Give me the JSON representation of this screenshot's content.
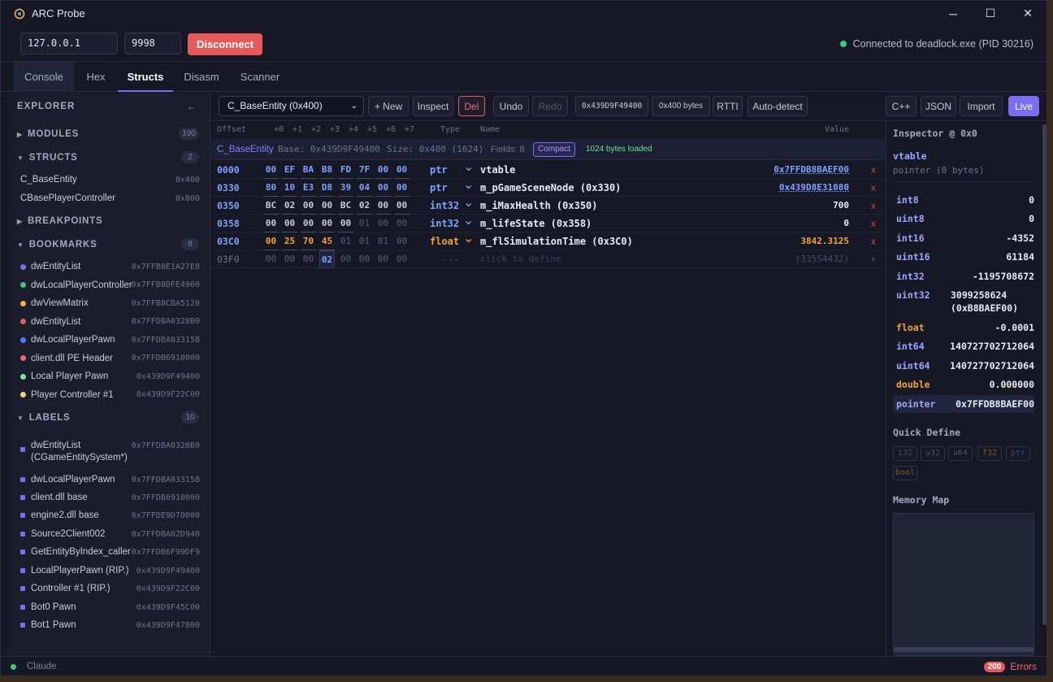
{
  "window": {
    "title": "ARC Probe",
    "minimize": "─",
    "maximize": "☐",
    "close": "✕"
  },
  "connection": {
    "host": "127.0.0.1",
    "port": "9998",
    "disconnect_label": "Disconnect",
    "status": "Connected to deadlock.exe (PID 30216)",
    "status_color": "#3ec97a"
  },
  "tabs": [
    "Console",
    "Hex",
    "Structs",
    "Disasm",
    "Scanner"
  ],
  "active_tab": "Structs",
  "sidebar": {
    "title": "EXPLORER",
    "collapse": "←",
    "modules": {
      "label": "MODULES",
      "count": "190"
    },
    "structs": {
      "label": "STRUCTS",
      "count": "2",
      "items": [
        {
          "name": "C_BaseEntity",
          "size": "0x400"
        },
        {
          "name": "CBasePlayerController",
          "size": "0x800"
        }
      ]
    },
    "breakpoints": {
      "label": "BREAKPOINTS"
    },
    "bookmarks": {
      "label": "BOOKMARKS",
      "count": "8",
      "items": [
        {
          "name": "dwEntityList",
          "addr": "0x7FFB0E1A27E8",
          "color": "#7c6df2"
        },
        {
          "name": "dwLocalPlayerController",
          "addr": "0x7FFB0DFE4900",
          "color": "#3ec97a"
        },
        {
          "name": "dwViewMatrix",
          "addr": "0x7FFB0CBA5120",
          "color": "#f0b43a"
        },
        {
          "name": "dwEntityList",
          "addr": "0x7FFDBA0328B0",
          "color": "#e45a5a"
        },
        {
          "name": "dwLocalPlayerPawn",
          "addr": "0x7FFDBA033158",
          "color": "#4a7cff"
        },
        {
          "name": "client.dll PE Header",
          "addr": "0x7FFDB6910000",
          "color": "#f06a6a"
        },
        {
          "name": "Local Player Pawn",
          "addr": "0x439D9F49400",
          "color": "#7ee0a0"
        },
        {
          "name": "Player Controller #1",
          "addr": "0x439D9F22C00",
          "color": "#f0d070"
        }
      ]
    },
    "labels": {
      "label": "LABELS",
      "count": "10",
      "items": [
        {
          "name": "dwEntityList",
          "name2": "(CGameEntitySystem*)",
          "addr": "0x7FFDBA0328B0"
        },
        {
          "name": "dwLocalPlayerPawn",
          "addr": "0x7FFDBA033158"
        },
        {
          "name": "client.dll base",
          "addr": "0x7FFDB6910000"
        },
        {
          "name": "engine2.dll base",
          "addr": "0x7FFDE9D70000"
        },
        {
          "name": "Source2Client002",
          "addr": "0x7FFDBA02D940"
        },
        {
          "name": "GetEntityByIndex_caller",
          "addr": "0x7FFDB6F99DF9"
        },
        {
          "name": "LocalPlayerPawn (RIP.)",
          "addr": "0x439D9F49400"
        },
        {
          "name": "Controller #1 (RIP.)",
          "addr": "0x439D9F22C00"
        },
        {
          "name": "Bot0 Pawn",
          "addr": "0x439D9F45C00"
        },
        {
          "name": "Bot1 Pawn",
          "addr": "0x439D9F47800"
        }
      ]
    }
  },
  "toolbar": {
    "struct_select": "C_BaseEntity (0x400)",
    "new": "+ New",
    "inspect": "Inspect",
    "del": "Del",
    "undo": "Undo",
    "redo": "Redo",
    "address": "0x439D9F49400",
    "size": "0x400 bytes",
    "rtti": "RTTI",
    "auto_detect": "Auto-detect",
    "cpp": "C++",
    "json": "JSON",
    "import": "Import",
    "live": "Live"
  },
  "table": {
    "headers": {
      "offset": "Offset",
      "bytes": [
        "+0",
        "+1",
        "+2",
        "+3",
        "+4",
        "+5",
        "+6",
        "+7"
      ],
      "type": "Type",
      "name": "Name",
      "value": "Value"
    },
    "structbar": {
      "name": "C_BaseEntity",
      "base": "Base: 0x439D9F49400",
      "size": "Size: 0x400 (1024)",
      "fields": "Fields: 8",
      "compact": "Compact",
      "loaded": "1024 bytes loaded"
    },
    "rows": [
      {
        "offset": "0000",
        "bytes": [
          "00",
          "EF",
          "BA",
          "B8",
          "FD",
          "7F",
          "00",
          "00"
        ],
        "type": "ptr",
        "name": "vtable",
        "value": "0x7FFDB8BAEF00"
      },
      {
        "offset": "0330",
        "bytes": [
          "80",
          "10",
          "E3",
          "D8",
          "39",
          "04",
          "00",
          "00"
        ],
        "type": "ptr",
        "name": "m_pGameSceneNode (0x330)",
        "value": "0x439D8E31080"
      },
      {
        "offset": "0350",
        "bytes": [
          "BC",
          "02",
          "00",
          "00",
          "BC",
          "02",
          "00",
          "00"
        ],
        "type": "int32",
        "name": "m_iMaxHealth (0x350)",
        "value": "700"
      },
      {
        "offset": "0358",
        "bytes": [
          "00",
          "00",
          "00",
          "00",
          "00",
          "01",
          "00",
          "00"
        ],
        "type": "int32",
        "name": "m_lifeState (0x358)",
        "value": "0"
      },
      {
        "offset": "03C0",
        "bytes": [
          "00",
          "25",
          "70",
          "45",
          "01",
          "01",
          "01",
          "00"
        ],
        "type": "float",
        "name": "m_flSimulationTime (0x3C0)",
        "value": "3842.3125"
      },
      {
        "offset": "03F0",
        "bytes": [
          "00",
          "00",
          "00",
          "02",
          "00",
          "00",
          "00",
          "00"
        ],
        "type": "---",
        "name": "click to define",
        "value": "(33554432)"
      }
    ],
    "delete_glyph": "x",
    "add_glyph": "+"
  },
  "inspector": {
    "title": "Inspector @ 0x0",
    "field_name": "vtable",
    "field_desc": "pointer (8 bytes)",
    "values": [
      {
        "k": "int8",
        "v": "0"
      },
      {
        "k": "uint8",
        "v": "0"
      },
      {
        "k": "int16",
        "v": "-4352"
      },
      {
        "k": "uint16",
        "v": "61184"
      },
      {
        "k": "int32",
        "v": "-1195708672"
      },
      {
        "k": "uint32",
        "v": "3099258624",
        "v2": "(0xB8BAEF00)"
      },
      {
        "k": "float",
        "v": "-0.0001"
      },
      {
        "k": "int64",
        "v": "140727702712064"
      },
      {
        "k": "uint64",
        "v": "140727702712064"
      },
      {
        "k": "double",
        "v": "0.000000"
      },
      {
        "k": "pointer",
        "v": "0x7FFDB8BAEF00"
      }
    ],
    "quick_define": "Quick Define",
    "quick_types": [
      "i32",
      "u32",
      "u64",
      "f32",
      "ptr",
      "bool"
    ],
    "memory_map": "Memory Map"
  },
  "statusbar": {
    "user": "Claude",
    "error_count": "200",
    "errors_label": "Errors"
  }
}
